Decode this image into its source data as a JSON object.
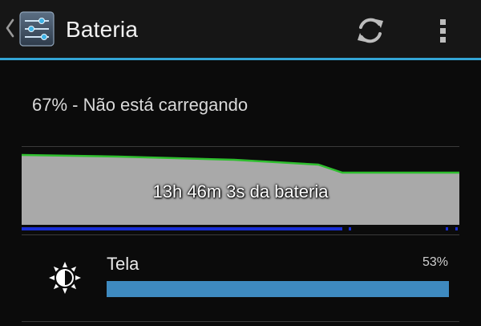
{
  "action_bar": {
    "title": "Bateria",
    "app_icon": "settings-sliders-icon",
    "back_icon": "chevron-left-icon",
    "refresh_icon": "refresh-icon",
    "overflow_icon": "overflow-menu-icon",
    "accent_color": "#33a5d6"
  },
  "status": {
    "text": "67% - Não está carregando"
  },
  "graph": {
    "label": "13h 46m 3s da bateria",
    "line_color": "#2fbf2f",
    "fill_color": "#a9a9a9",
    "charge_bar_color": "#1a2fd6"
  },
  "usage": {
    "items": [
      {
        "label": "Tela",
        "percent_label": "53%",
        "percent": 53,
        "icon": "brightness-icon",
        "bar_color": "#3e8ac0"
      }
    ]
  }
}
